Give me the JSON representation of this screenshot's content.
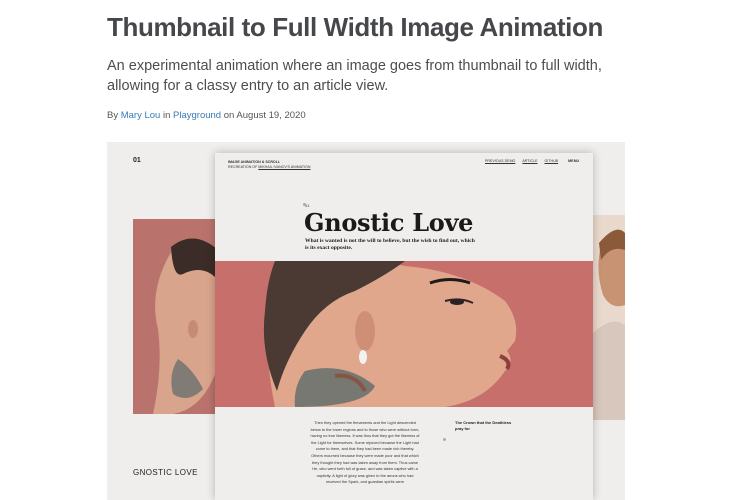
{
  "article": {
    "title": "Thumbnail to Full Width Image Animation",
    "description": "An experimental animation where an image goes from thumbnail to full width, allowing for a classy entry to an article view.",
    "byline": {
      "by": "By",
      "author": "Mary Lou",
      "in": "in",
      "category": "Playground",
      "on": "on August 19, 2020"
    }
  },
  "preview": {
    "left_number": "01",
    "left_caption": "GNOSTIC LOVE",
    "card": {
      "brand_line1": "IMAGE ANIMATION & SCROLL",
      "brand_line2_prefix": "RECREATION OF",
      "brand_line2_link": "MIKHAIL IVANOV'S ANIMATION",
      "nav": [
        "PREVIOUS DEMO",
        "ARTICLE",
        "GITHUB"
      ],
      "menu": "MENU",
      "number": "01",
      "title": "Gnostic Love",
      "quote": "What is wanted is not the will to believe, but the wish to find out, which is its exact opposite.",
      "body": "Then they opened the firmaments and the Light descended below to the lower regions and to those who were without form, having no true likeness. It was thus that they got the likeness of the Light for themselves. Some rejoiced because the Light had come to them, and that they had been made rich thereby. Others mourned because they were made poor and that which they thought they had was taken away from them. Thus came He, who went forth full of grace, and was taken captive with a captivity. A light of glory was given to the aeons who had received the Spark, and guardian spirits were",
      "aside": "The Crown that the Deathless pray for"
    },
    "colors": {
      "hero_bg": "#c7706b",
      "page_bg": "#efeeec"
    }
  }
}
